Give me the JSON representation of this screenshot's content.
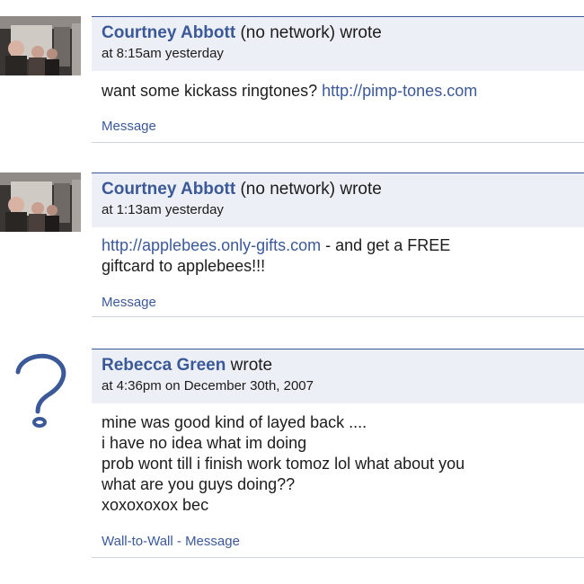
{
  "posts": [
    {
      "author": "Courtney Abbott",
      "network": "(no network)",
      "verb": "wrote",
      "timestamp": "at 8:15am yesterday",
      "avatar": "person-photo",
      "body_text": "want some kickass ringtones?",
      "body_link": "http://pimp-tones.com",
      "actions": [
        "Message"
      ]
    },
    {
      "author": "Courtney Abbott",
      "network": "(no network)",
      "verb": "wrote",
      "timestamp": "at 1:13am yesterday",
      "avatar": "person-photo",
      "body_link": "http://applebees.only-gifts.com",
      "body_text_1": " - and get a FREE",
      "body_text_2": "giftcard to applebees!!!",
      "actions": [
        "Message"
      ]
    },
    {
      "author": "Rebecca Green",
      "verb": "wrote",
      "timestamp": "at 4:36pm on December 30th, 2007",
      "avatar": "question-mark-placeholder",
      "body_lines": [
        "mine was good kind of layed back ....",
        "i have no idea what im doing",
        "prob wont till i finish work tomoz lol what about you",
        "what are you guys doing??",
        "xoxoxoxox bec"
      ],
      "actions": [
        "Wall-to-Wall",
        "Message"
      ],
      "action_separator": " - "
    }
  ],
  "colors": {
    "link": "#3b5998",
    "header_bg": "#eceff5",
    "rule": "#d0d4dc"
  }
}
